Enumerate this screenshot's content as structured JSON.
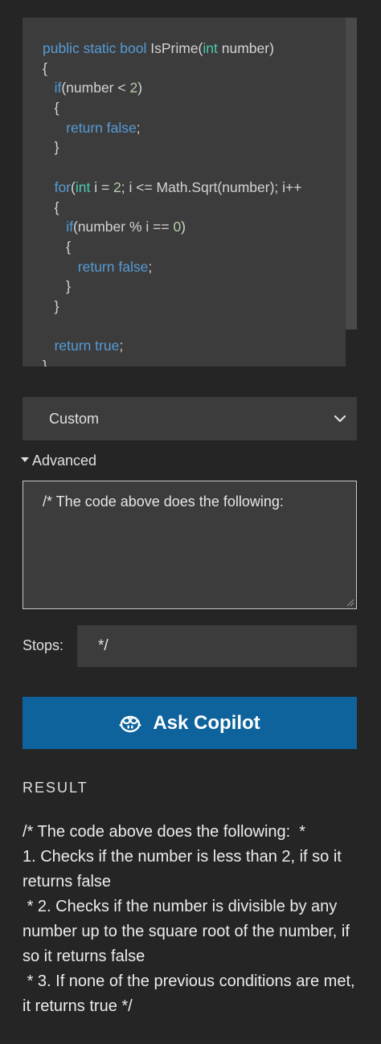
{
  "code": {
    "lines": [
      [
        {
          "t": "public static bool ",
          "c": "kw"
        },
        {
          "t": "IsPrime(",
          "c": ""
        },
        {
          "t": "int",
          "c": "ty"
        },
        {
          "t": " number)",
          "c": ""
        }
      ],
      [
        {
          "t": "{",
          "c": ""
        }
      ],
      [
        {
          "t": "   ",
          "c": ""
        },
        {
          "t": "if",
          "c": "kw"
        },
        {
          "t": "(number < ",
          "c": ""
        },
        {
          "t": "2",
          "c": "num"
        },
        {
          "t": ")",
          "c": ""
        }
      ],
      [
        {
          "t": "   {",
          "c": ""
        }
      ],
      [
        {
          "t": "      ",
          "c": ""
        },
        {
          "t": "return false",
          "c": "kw"
        },
        {
          "t": ";",
          "c": ""
        }
      ],
      [
        {
          "t": "   }",
          "c": ""
        }
      ],
      [
        {
          "t": "",
          "c": ""
        }
      ],
      [
        {
          "t": "   ",
          "c": ""
        },
        {
          "t": "for",
          "c": "kw"
        },
        {
          "t": "(",
          "c": ""
        },
        {
          "t": "int",
          "c": "ty"
        },
        {
          "t": " i = ",
          "c": ""
        },
        {
          "t": "2",
          "c": "num"
        },
        {
          "t": "; i <= Math.Sqrt(number); i++",
          "c": ""
        }
      ],
      [
        {
          "t": "   {",
          "c": ""
        }
      ],
      [
        {
          "t": "      ",
          "c": ""
        },
        {
          "t": "if",
          "c": "kw"
        },
        {
          "t": "(number % i == ",
          "c": ""
        },
        {
          "t": "0",
          "c": "num"
        },
        {
          "t": ")",
          "c": ""
        }
      ],
      [
        {
          "t": "      {",
          "c": ""
        }
      ],
      [
        {
          "t": "         ",
          "c": ""
        },
        {
          "t": "return false",
          "c": "kw"
        },
        {
          "t": ";",
          "c": ""
        }
      ],
      [
        {
          "t": "      }",
          "c": ""
        }
      ],
      [
        {
          "t": "   }",
          "c": ""
        }
      ],
      [
        {
          "t": "",
          "c": ""
        }
      ],
      [
        {
          "t": "   ",
          "c": ""
        },
        {
          "t": "return true",
          "c": "kw"
        },
        {
          "t": ";",
          "c": ""
        }
      ],
      [
        {
          "t": "}",
          "c": ""
        }
      ]
    ]
  },
  "mode_select": {
    "value": "Custom",
    "icon": "chevron-down-icon"
  },
  "advanced": {
    "label": "Advanced"
  },
  "prompt": {
    "value": "/* The code above does the following:"
  },
  "stops": {
    "label": "Stops:",
    "value": "*/"
  },
  "ask_button": {
    "label": "Ask Copilot",
    "icon": "copilot-icon"
  },
  "result": {
    "heading": "RESULT",
    "text": "/* The code above does the following:  *\n1. Checks if the number is less than 2, if so it returns false\n * 2. Checks if the number is divisible by any number up to the square root of the number, if so it returns false\n * 3. If none of the previous conditions are met, it returns true */"
  },
  "colors": {
    "background": "#252526",
    "panel": "#3c3c3c",
    "button": "#0e639c",
    "keyword": "#569cd6",
    "type": "#4ec9b0",
    "number": "#b5cea8"
  }
}
